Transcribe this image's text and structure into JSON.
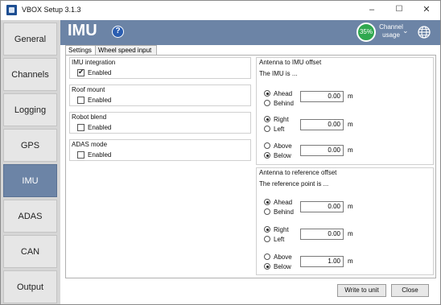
{
  "window": {
    "title": "VBOX Setup 3.1.3"
  },
  "titlebar_buttons": {
    "minimize": "–",
    "maximize": "☐",
    "close": "✕"
  },
  "sidebar": {
    "items": [
      {
        "label": "General"
      },
      {
        "label": "Channels"
      },
      {
        "label": "Logging"
      },
      {
        "label": "GPS"
      },
      {
        "label": "IMU",
        "active": true
      },
      {
        "label": "ADAS"
      },
      {
        "label": "CAN"
      },
      {
        "label": "Output"
      }
    ]
  },
  "header": {
    "title": "IMU",
    "help_icon": "?",
    "channel_usage_percent": "35%",
    "channel_usage_label": "Channel usage",
    "accent_color": "#6c84a6",
    "usage_color": "#2fa84f"
  },
  "tabs": [
    {
      "label": "Settings",
      "active": true
    },
    {
      "label": "Wheel speed input"
    }
  ],
  "settings": {
    "imu_integration": {
      "title": "IMU integration",
      "label": "Enabled",
      "checked": true
    },
    "roof_mount": {
      "title": "Roof mount",
      "label": "Enabled",
      "checked": false
    },
    "robot_blend": {
      "title": "Robot blend",
      "label": "Enabled",
      "checked": false
    },
    "adas_mode": {
      "title": "ADAS mode",
      "label": "Enabled",
      "checked": false
    }
  },
  "antenna_imu": {
    "title": "Antenna to IMU offset",
    "subtitle": "The IMU is ...",
    "rows": [
      {
        "opt1": "Ahead",
        "opt2": "Behind",
        "selected": "Ahead",
        "value": "0.00",
        "unit": "m"
      },
      {
        "opt1": "Right",
        "opt2": "Left",
        "selected": "Right",
        "value": "0.00",
        "unit": "m"
      },
      {
        "opt1": "Above",
        "opt2": "Below",
        "selected": "Below",
        "value": "0.00",
        "unit": "m"
      }
    ]
  },
  "antenna_ref": {
    "title": "Antenna to reference offset",
    "subtitle": "The reference point is ...",
    "rows": [
      {
        "opt1": "Ahead",
        "opt2": "Behind",
        "selected": "Ahead",
        "value": "0.00",
        "unit": "m"
      },
      {
        "opt1": "Right",
        "opt2": "Left",
        "selected": "Right",
        "value": "0.00",
        "unit": "m"
      },
      {
        "opt1": "Above",
        "opt2": "Below",
        "selected": "Below",
        "value": "1.00",
        "unit": "m"
      }
    ]
  },
  "footer": {
    "write_label": "Write to unit",
    "close_label": "Close"
  }
}
